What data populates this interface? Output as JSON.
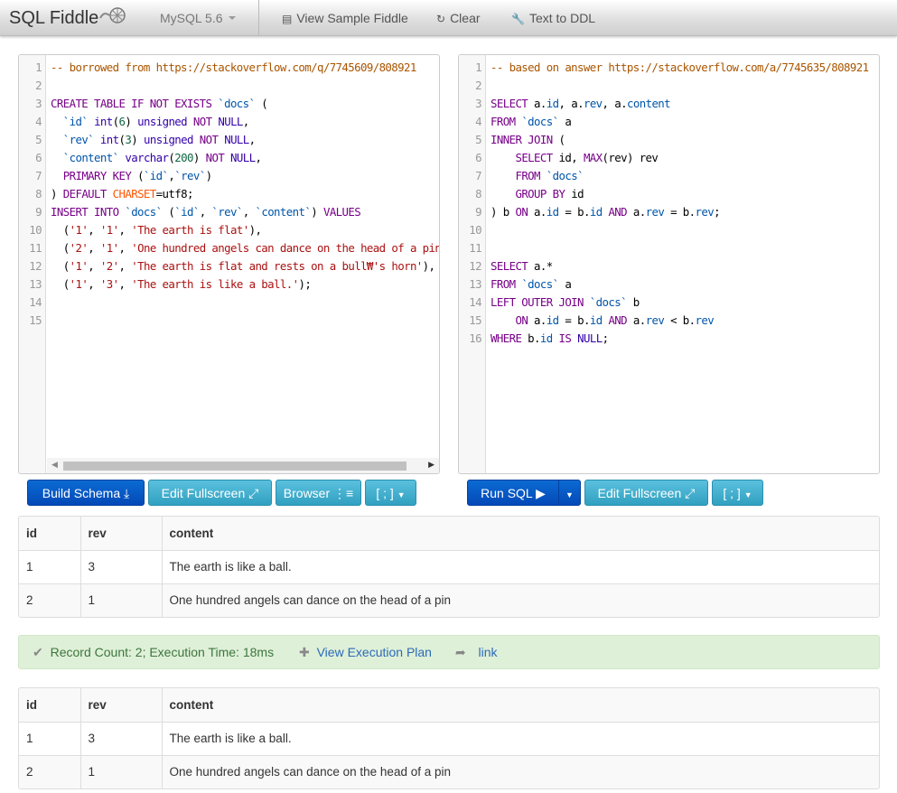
{
  "navbar": {
    "brand": "SQL Fiddle",
    "db_select": "MySQL 5.6",
    "view_sample": "View Sample Fiddle",
    "clear": "Clear",
    "text_to_ddl": "Text to DDL"
  },
  "schema": {
    "lines": [
      [
        [
          "c",
          "-- borrowed from https://stackoverflow.com/q/7745609/808921"
        ]
      ],
      [],
      [
        [
          "k",
          "CREATE TABLE IF NOT EXISTS "
        ],
        [
          "v",
          "`docs`"
        ],
        [
          "p",
          " ("
        ]
      ],
      [
        [
          "p",
          "  "
        ],
        [
          "v",
          "`id`"
        ],
        [
          "p",
          " "
        ],
        [
          "b",
          "int"
        ],
        [
          "p",
          "("
        ],
        [
          "n",
          "6"
        ],
        [
          "p",
          ") "
        ],
        [
          "b",
          "unsigned "
        ],
        [
          "k",
          "NOT "
        ],
        [
          "b",
          "NULL"
        ],
        [
          "p",
          ","
        ]
      ],
      [
        [
          "p",
          "  "
        ],
        [
          "v",
          "`rev`"
        ],
        [
          "p",
          " "
        ],
        [
          "b",
          "int"
        ],
        [
          "p",
          "("
        ],
        [
          "n",
          "3"
        ],
        [
          "p",
          ") "
        ],
        [
          "b",
          "unsigned "
        ],
        [
          "k",
          "NOT "
        ],
        [
          "b",
          "NULL"
        ],
        [
          "p",
          ","
        ]
      ],
      [
        [
          "p",
          "  "
        ],
        [
          "v",
          "`content`"
        ],
        [
          "p",
          " "
        ],
        [
          "b",
          "varchar"
        ],
        [
          "p",
          "("
        ],
        [
          "n",
          "200"
        ],
        [
          "p",
          ") "
        ],
        [
          "k",
          "NOT "
        ],
        [
          "b",
          "NULL"
        ],
        [
          "p",
          ","
        ]
      ],
      [
        [
          "p",
          "  "
        ],
        [
          "k",
          "PRIMARY KEY"
        ],
        [
          "p",
          " ("
        ],
        [
          "v",
          "`id`"
        ],
        [
          "p",
          ","
        ],
        [
          "v",
          "`rev`"
        ],
        [
          "p",
          ")"
        ]
      ],
      [
        [
          "p",
          ") "
        ],
        [
          "k",
          "DEFAULT "
        ],
        [
          "a",
          "CHARSET"
        ],
        [
          "p",
          "=utf8;"
        ]
      ],
      [
        [
          "k",
          "INSERT INTO "
        ],
        [
          "v",
          "`docs`"
        ],
        [
          "p",
          " ("
        ],
        [
          "v",
          "`id`"
        ],
        [
          "p",
          ", "
        ],
        [
          "v",
          "`rev`"
        ],
        [
          "p",
          ", "
        ],
        [
          "v",
          "`content`"
        ],
        [
          "p",
          ") "
        ],
        [
          "k",
          "VALUES"
        ]
      ],
      [
        [
          "p",
          "  ("
        ],
        [
          "s",
          "'1'"
        ],
        [
          "p",
          ", "
        ],
        [
          "s",
          "'1'"
        ],
        [
          "p",
          ", "
        ],
        [
          "s",
          "'The earth is flat'"
        ],
        [
          "p",
          "),"
        ]
      ],
      [
        [
          "p",
          "  ("
        ],
        [
          "s",
          "'2'"
        ],
        [
          "p",
          ", "
        ],
        [
          "s",
          "'1'"
        ],
        [
          "p",
          ", "
        ],
        [
          "s",
          "'One hundred angels can dance on the head of a pin'"
        ],
        [
          "p",
          "),"
        ]
      ],
      [
        [
          "p",
          "  ("
        ],
        [
          "s",
          "'1'"
        ],
        [
          "p",
          ", "
        ],
        [
          "s",
          "'2'"
        ],
        [
          "p",
          ", "
        ],
        [
          "s",
          "'The earth is flat and rests on a bull₩'s horn'"
        ],
        [
          "p",
          "),"
        ]
      ],
      [
        [
          "p",
          "  ("
        ],
        [
          "s",
          "'1'"
        ],
        [
          "p",
          ", "
        ],
        [
          "s",
          "'3'"
        ],
        [
          "p",
          ", "
        ],
        [
          "s",
          "'The earth is like a ball.'"
        ],
        [
          "p",
          ");"
        ]
      ],
      [],
      []
    ]
  },
  "query": {
    "lines": [
      [
        [
          "c",
          "-- based on answer https://stackoverflow.com/a/7745635/808921"
        ]
      ],
      [],
      [
        [
          "k",
          "SELECT "
        ],
        [
          "p",
          "a."
        ],
        [
          "v",
          "id"
        ],
        [
          "p",
          ", a."
        ],
        [
          "v",
          "rev"
        ],
        [
          "p",
          ", a."
        ],
        [
          "v",
          "content"
        ]
      ],
      [
        [
          "k",
          "FROM "
        ],
        [
          "v",
          "`docs`"
        ],
        [
          "p",
          " a"
        ]
      ],
      [
        [
          "k",
          "INNER JOIN"
        ],
        [
          "p",
          " ("
        ]
      ],
      [
        [
          "p",
          "    "
        ],
        [
          "k",
          "SELECT "
        ],
        [
          "p",
          "id, "
        ],
        [
          "k",
          "MAX"
        ],
        [
          "p",
          "(rev) rev"
        ]
      ],
      [
        [
          "p",
          "    "
        ],
        [
          "k",
          "FROM "
        ],
        [
          "v",
          "`docs`"
        ]
      ],
      [
        [
          "p",
          "    "
        ],
        [
          "k",
          "GROUP BY "
        ],
        [
          "p",
          "id"
        ]
      ],
      [
        [
          "p",
          ") b "
        ],
        [
          "k",
          "ON "
        ],
        [
          "p",
          "a."
        ],
        [
          "v",
          "id"
        ],
        [
          "p",
          " = b."
        ],
        [
          "v",
          "id"
        ],
        [
          "p",
          " "
        ],
        [
          "k",
          "AND "
        ],
        [
          "p",
          "a."
        ],
        [
          "v",
          "rev"
        ],
        [
          "p",
          " = b."
        ],
        [
          "v",
          "rev"
        ],
        [
          "p",
          ";"
        ]
      ],
      [],
      [],
      [
        [
          "k",
          "SELECT "
        ],
        [
          "p",
          "a.*"
        ]
      ],
      [
        [
          "k",
          "FROM "
        ],
        [
          "v",
          "`docs`"
        ],
        [
          "p",
          " a"
        ]
      ],
      [
        [
          "k",
          "LEFT OUTER JOIN "
        ],
        [
          "v",
          "`docs`"
        ],
        [
          "p",
          " b"
        ]
      ],
      [
        [
          "p",
          "    "
        ],
        [
          "k",
          "ON "
        ],
        [
          "p",
          "a."
        ],
        [
          "v",
          "id"
        ],
        [
          "p",
          " = b."
        ],
        [
          "v",
          "id"
        ],
        [
          "p",
          " "
        ],
        [
          "k",
          "AND "
        ],
        [
          "p",
          "a."
        ],
        [
          "v",
          "rev"
        ],
        [
          "p",
          " < b."
        ],
        [
          "v",
          "rev"
        ]
      ],
      [
        [
          "k",
          "WHERE "
        ],
        [
          "p",
          "b."
        ],
        [
          "v",
          "id"
        ],
        [
          "p",
          " "
        ],
        [
          "k",
          "IS "
        ],
        [
          "b",
          "NULL"
        ],
        [
          "p",
          ";"
        ]
      ]
    ]
  },
  "schema_buttons": {
    "build": "Build Schema",
    "fullscreen": "Edit Fullscreen",
    "browser": "Browser",
    "delimiter": "[ ; ]"
  },
  "query_buttons": {
    "run": "Run SQL",
    "fullscreen": "Edit Fullscreen",
    "delimiter": "[ ; ]"
  },
  "results": [
    {
      "headers": [
        "id",
        "rev",
        "content"
      ],
      "rows": [
        [
          "1",
          "3",
          "The earth is like a ball."
        ],
        [
          "2",
          "1",
          "One hundred angels can dance on the head of a pin"
        ]
      ]
    },
    {
      "headers": [
        "id",
        "rev",
        "content"
      ],
      "rows": [
        [
          "1",
          "3",
          "The earth is like a ball."
        ],
        [
          "2",
          "1",
          "One hundred angels can dance on the head of a pin"
        ]
      ]
    }
  ],
  "status": {
    "text": "Record Count: 2; Execution Time: 18ms",
    "execution_plan": "View Execution Plan",
    "link": "link"
  },
  "colors": {
    "primary": "#0449b8",
    "info": "#5bc0de",
    "success_bg": "#dff0d8"
  }
}
